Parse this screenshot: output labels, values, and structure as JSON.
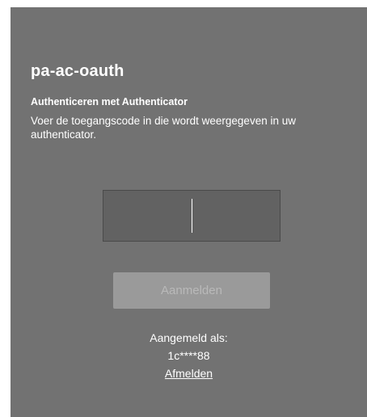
{
  "app": {
    "title": "pa-ac-oauth"
  },
  "auth": {
    "heading": "Authenticeren met Authenticator",
    "instructions": "Voer de toegangscode in die wordt weergegeven in uw authenticator.",
    "code_value": "",
    "submit_label": "Aanmelden"
  },
  "session": {
    "signed_in_label": "Aangemeld als:",
    "username": "1c****88",
    "signout_label": "Afmelden"
  },
  "colors": {
    "panel_bg": "#727272",
    "input_bg": "#626262",
    "button_disabled_bg": "#9a9a9a",
    "text": "#ffffff"
  }
}
